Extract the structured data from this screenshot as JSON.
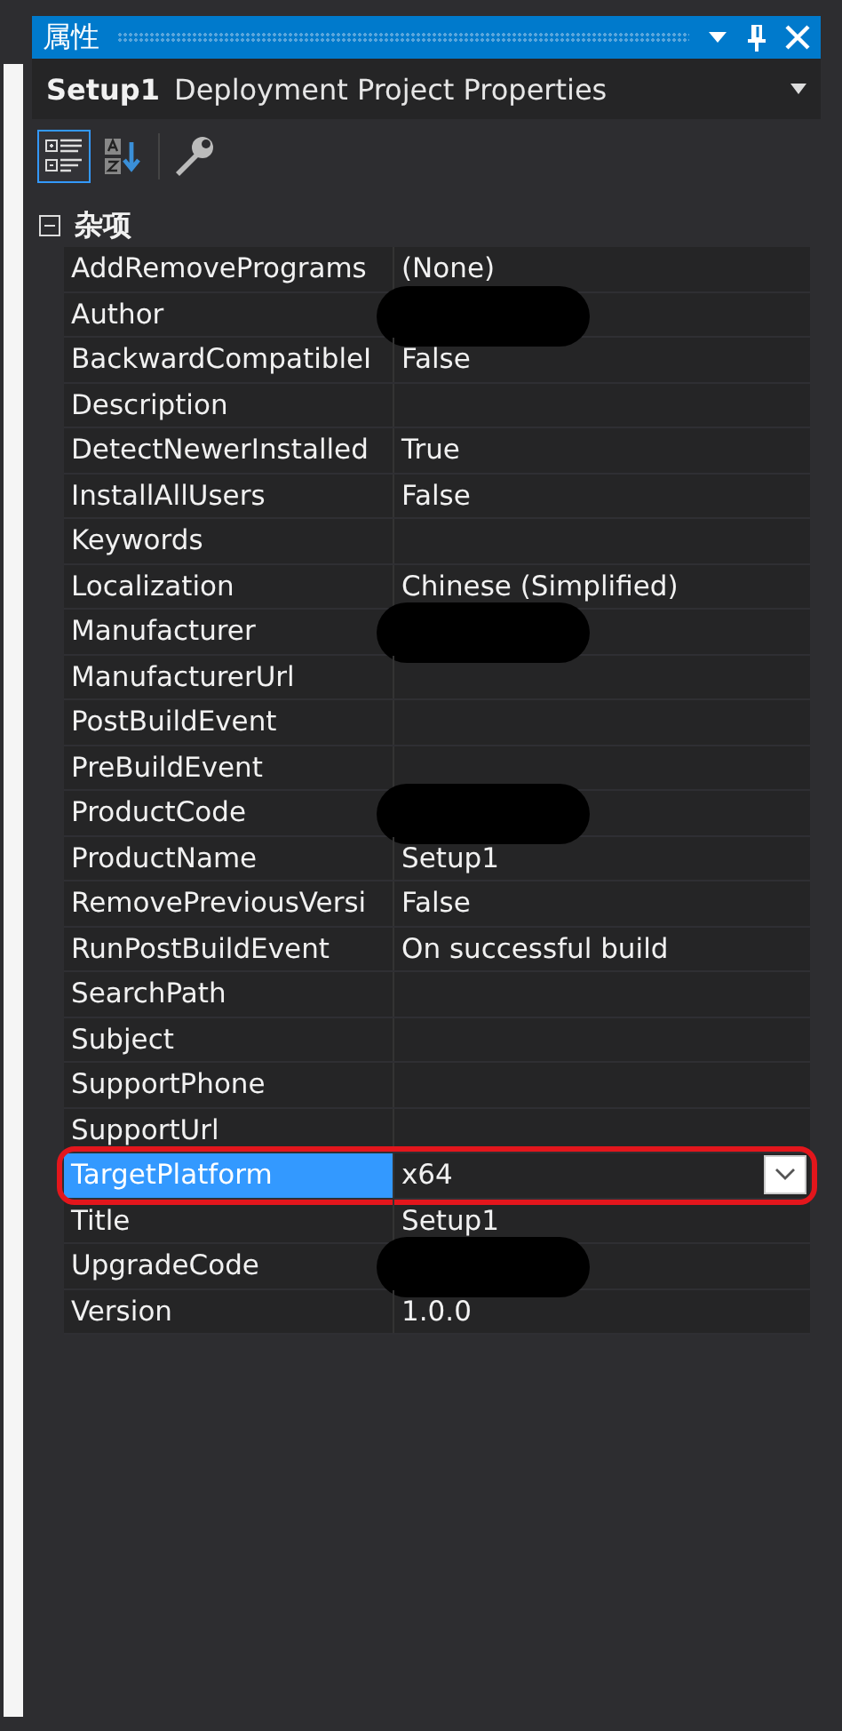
{
  "window": {
    "title": "属性"
  },
  "object_selector": {
    "name": "Setup1",
    "type": "Deployment Project Properties"
  },
  "toolbar": [
    {
      "kind": "categorized",
      "selected": true
    },
    {
      "kind": "alphabetical",
      "selected": false
    },
    {
      "kind": "property_pages",
      "selected": false
    }
  ],
  "category": {
    "label": "杂项",
    "expanded": true
  },
  "properties": [
    {
      "name": "AddRemovePrograms",
      "value": "(None)",
      "selected": false
    },
    {
      "name": "Author",
      "selected": false,
      "redacted": true
    },
    {
      "name": "BackwardCompatibleI",
      "value": "False",
      "selected": false
    },
    {
      "name": "Description",
      "selected": false
    },
    {
      "name": "DetectNewerInstalled",
      "value": "True",
      "selected": false
    },
    {
      "name": "InstallAllUsers",
      "value": "False",
      "selected": false
    },
    {
      "name": "Keywords",
      "selected": false
    },
    {
      "name": "Localization",
      "value": "Chinese (Simplified)",
      "selected": false
    },
    {
      "name": "Manufacturer",
      "selected": false,
      "redacted": true
    },
    {
      "name": "ManufacturerUrl",
      "selected": false
    },
    {
      "name": "PostBuildEvent",
      "selected": false
    },
    {
      "name": "PreBuildEvent",
      "selected": false
    },
    {
      "name": "ProductCode",
      "selected": false,
      "redacted": true
    },
    {
      "name": "ProductName",
      "value": "Setup1",
      "selected": false
    },
    {
      "name": "RemovePreviousVersi",
      "value": "False",
      "selected": false
    },
    {
      "name": "RunPostBuildEvent",
      "value": "On successful build",
      "selected": false
    },
    {
      "name": "SearchPath",
      "selected": false
    },
    {
      "name": "Subject",
      "selected": false
    },
    {
      "name": "SupportPhone",
      "selected": false
    },
    {
      "name": "SupportUrl",
      "selected": false
    },
    {
      "name": "TargetPlatform",
      "value": "x64",
      "selected": true,
      "annotated": true
    },
    {
      "name": "Title",
      "value": "Setup1",
      "selected": false
    },
    {
      "name": "UpgradeCode",
      "selected": false,
      "redacted": true
    },
    {
      "name": "Version",
      "value": "1.0.0",
      "selected": false
    }
  ]
}
